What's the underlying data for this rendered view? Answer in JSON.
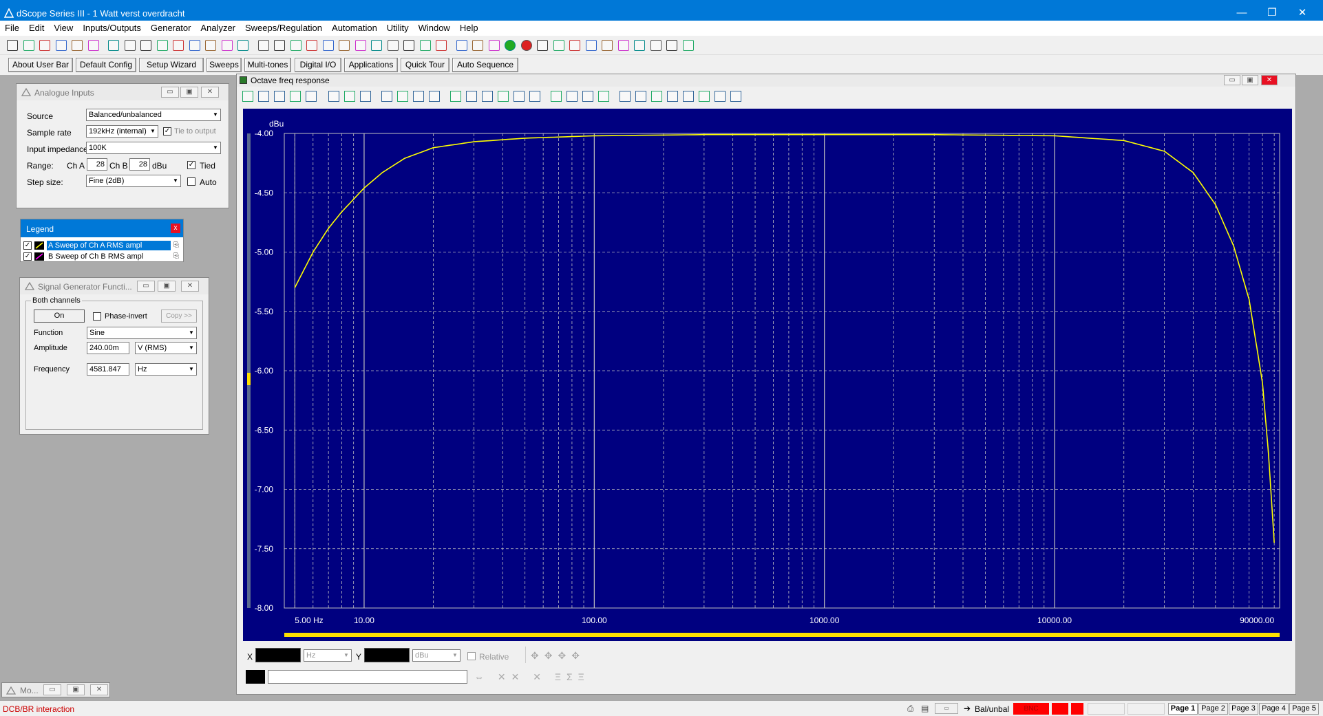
{
  "window": {
    "title": "dScope Series III - 1 Watt verst overdracht",
    "minimize_glyph": "—",
    "maximize_glyph": "❐",
    "close_glyph": "✕"
  },
  "menu": [
    "File",
    "Edit",
    "View",
    "Inputs/Outputs",
    "Generator",
    "Analyzer",
    "Sweeps/Regulation",
    "Automation",
    "Utility",
    "Window",
    "Help"
  ],
  "quickbar": [
    "About User Bar",
    "Default Config",
    "Setup Wizard",
    "Sweeps",
    "Multi-tones",
    "Digital I/O",
    "Applications",
    "Quick Tour",
    "Auto Sequence"
  ],
  "analogue_inputs": {
    "title": "Analogue Inputs",
    "source_label": "Source",
    "source_value": "Balanced/unbalanced",
    "sample_rate_label": "Sample rate",
    "sample_rate_value": "192kHz (internal)",
    "tie_label": "Tie to output",
    "impedance_label": "Input impedance",
    "impedance_value": "100K",
    "range_label": "Range:",
    "cha_label": "Ch A",
    "cha_value": "28",
    "chb_label": "Ch B",
    "chb_value": "28",
    "range_unit": "dBu",
    "tied_label": "Tied",
    "step_label": "Step size:",
    "step_value": "Fine (2dB)",
    "auto_label": "Auto"
  },
  "legend": {
    "title": "Legend",
    "close_glyph": "x",
    "items": [
      {
        "label": "A  Sweep of Ch A RMS ampl",
        "color": "#ffff00"
      },
      {
        "label": "B  Sweep of Ch B RMS ampl",
        "color": "#ff00ff"
      }
    ]
  },
  "signal_generator": {
    "title": "Signal Generator Functi...",
    "group_label": "Both channels",
    "on_label": "On",
    "phase_invert_label": "Phase-invert",
    "copy_label": "Copy >>",
    "function_label": "Function",
    "function_value": "Sine",
    "amplitude_label": "Amplitude",
    "amplitude_value": "240.00m",
    "amplitude_unit": "V (RMS)",
    "frequency_label": "Frequency",
    "frequency_value": "4581.847",
    "frequency_unit": "Hz"
  },
  "minimized": {
    "label": "Mo..."
  },
  "graph_window": {
    "title": "Octave freq response",
    "x_label": "X",
    "x_unit": "Hz",
    "y_label": "Y",
    "y_unit": "dBu",
    "relative_label": "Relative"
  },
  "chart_data": {
    "type": "line",
    "title": "",
    "xlabel": "",
    "ylabel": "dBu",
    "x_scale": "log",
    "xlim": [
      4.5,
      95000
    ],
    "ylim": [
      -8.0,
      -4.0
    ],
    "y_ticks": [
      "-4.00",
      "-4.50",
      "-5.00",
      "-5.50",
      "-6.00",
      "-6.50",
      "-7.00",
      "-7.50",
      "-8.00"
    ],
    "x_ticks": [
      "5.00 Hz",
      "10.00",
      "100.00",
      "1000.00",
      "10000.00",
      "90000.00"
    ],
    "x_tick_values": [
      5,
      10,
      100,
      1000,
      10000,
      90000
    ],
    "background": "#000080",
    "series": [
      {
        "name": "A  Sweep of Ch A RMS ampl",
        "color": "#ffff00",
        "x": [
          5,
          6,
          7,
          8,
          10,
          12,
          15,
          20,
          30,
          50,
          100,
          300,
          1000,
          3000,
          10000,
          20000,
          30000,
          40000,
          50000,
          60000,
          70000,
          80000,
          85000,
          90000
        ],
        "y": [
          -5.3,
          -5.0,
          -4.8,
          -4.66,
          -4.46,
          -4.33,
          -4.21,
          -4.12,
          -4.07,
          -4.04,
          -4.02,
          -4.01,
          -4.01,
          -4.01,
          -4.02,
          -4.06,
          -4.15,
          -4.33,
          -4.6,
          -4.95,
          -5.4,
          -6.1,
          -6.7,
          -7.45
        ]
      }
    ]
  },
  "statusbar": {
    "left_text": "DCB/BR interaction",
    "sig_label": "Bal/unbal",
    "bnc_label": "BNC",
    "pages": [
      "Page 1",
      "Page 2",
      "Page 3",
      "Page 4",
      "Page 5"
    ]
  },
  "colors": {
    "titlebar": "#0078d7",
    "plot_bg": "#000080",
    "trace": "#ffff00",
    "status_red": "#ff0000"
  }
}
